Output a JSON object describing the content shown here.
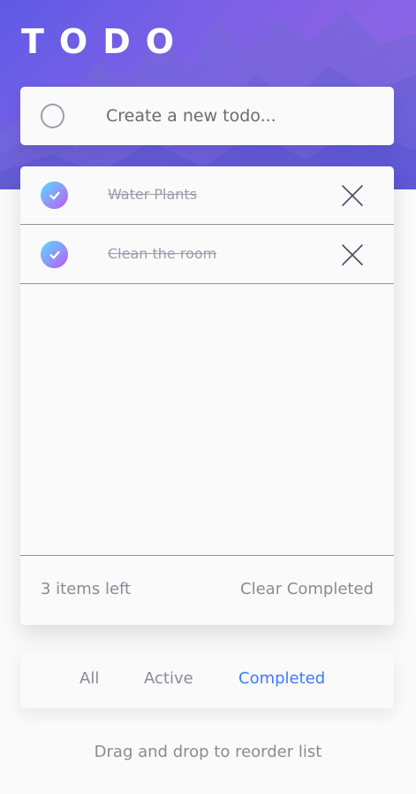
{
  "app": {
    "title": "TODO",
    "theme_icon": "moon-icon"
  },
  "new_todo": {
    "placeholder": "Create a new todo..."
  },
  "todos": [
    {
      "text": "Water Plants",
      "completed": true
    },
    {
      "text": "Clean the room",
      "completed": true
    }
  ],
  "footer": {
    "items_left": "3 items left",
    "clear_completed": "Clear Completed"
  },
  "filters": {
    "all": "All",
    "active": "Active",
    "completed": "Completed",
    "selected": "Completed"
  },
  "hint": "Drag and drop to reorder list",
  "colors": {
    "accent": "#3a7cfd",
    "check_gradient_start": "#57ddff",
    "check_gradient_end": "#c058f3"
  }
}
